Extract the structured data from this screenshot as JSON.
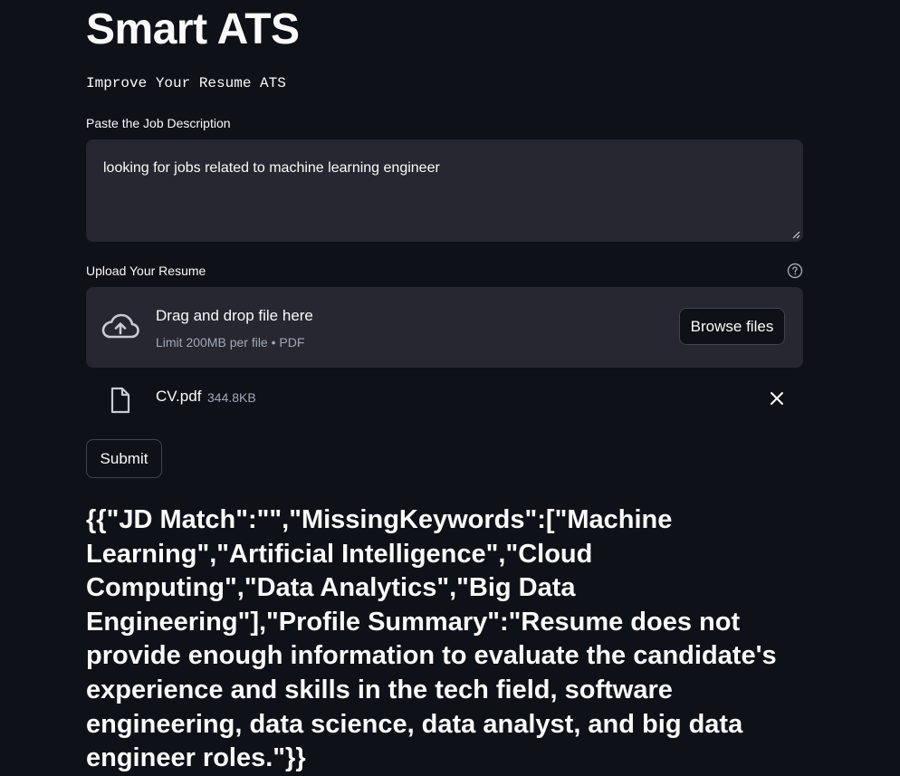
{
  "app": {
    "title": "Smart ATS",
    "subtitle": "Improve Your Resume ATS"
  },
  "job_description": {
    "label": "Paste the Job Description",
    "value": "looking for jobs related to machine learning engineer"
  },
  "upload": {
    "label": "Upload Your Resume",
    "help_icon": "question-circle-icon",
    "dropzone_title": "Drag and drop file here",
    "dropzone_hint": "Limit 200MB per file • PDF",
    "browse_label": "Browse files",
    "upload_icon": "cloud-upload-icon"
  },
  "uploaded_file": {
    "name": "CV.pdf",
    "size": "344.8KB",
    "file_icon": "file-icon",
    "remove_icon": "close-icon"
  },
  "submit": {
    "label": "Submit"
  },
  "result": {
    "text": "{{\"JD Match\":\"\",\"MissingKeywords\":[\"Machine Learning\",\"Artificial Intelligence\",\"Cloud Computing\",\"Data Analytics\",\"Big Data Engineering\"],\"Profile Summary\":\"Resume does not provide enough information to evaluate the candidate's experience and skills in the tech field, software engineering, data science, data analyst, and big data engineer roles.\"}}"
  },
  "colors": {
    "background": "#0e1117",
    "input_background": "#262730",
    "text": "#fafafa",
    "muted_text": "#a3a8b8"
  }
}
